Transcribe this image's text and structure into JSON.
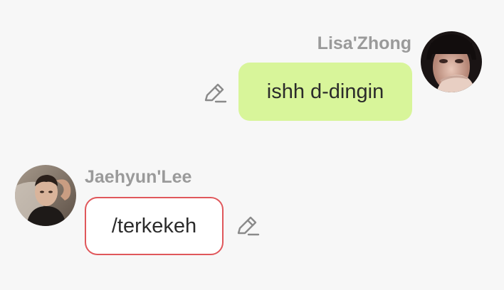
{
  "messages": [
    {
      "sender": "Lisa'Zhong",
      "text": "ishh d-dingin",
      "side": "right",
      "bubble_color": "#d8f59a",
      "avatar_icon": "avatar-lisa"
    },
    {
      "sender": "Jaehyun'Lee",
      "text": "/terkekeh",
      "side": "left",
      "bubble_color": "#ffffff",
      "border_color": "#e0575b",
      "avatar_icon": "avatar-jaehyun"
    }
  ],
  "icons": {
    "edit": "pencil-icon"
  }
}
